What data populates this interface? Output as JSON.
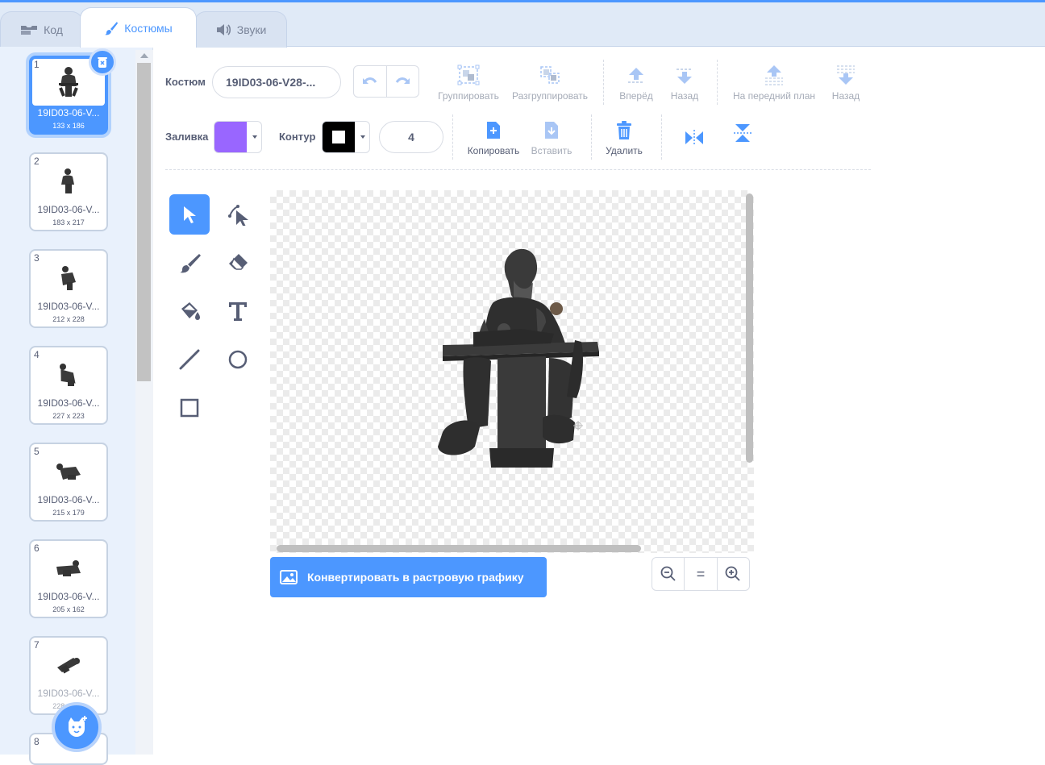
{
  "tabs": [
    {
      "label": "Код",
      "icon": "code-blocks-icon"
    },
    {
      "label": "Костюмы",
      "icon": "paintbrush-icon"
    },
    {
      "label": "Звуки",
      "icon": "speaker-icon"
    }
  ],
  "costumes": [
    {
      "number": "1",
      "name": "19ID03-06-V...",
      "size": "133 x 186"
    },
    {
      "number": "2",
      "name": "19ID03-06-V...",
      "size": "183 x 217"
    },
    {
      "number": "3",
      "name": "19ID03-06-V...",
      "size": "212 x 228"
    },
    {
      "number": "4",
      "name": "19ID03-06-V...",
      "size": "227 x 223"
    },
    {
      "number": "5",
      "name": "19ID03-06-V...",
      "size": "215 x 179"
    },
    {
      "number": "6",
      "name": "19ID03-06-V...",
      "size": "205 x 162"
    },
    {
      "number": "7",
      "name": "19ID03-06-V...",
      "size": "228 x 227"
    },
    {
      "number": "8",
      "name": "",
      "size": ""
    }
  ],
  "toolbar": {
    "costume_label": "Костюм",
    "costume_name": "19ID03-06-V28-...",
    "group": "Группировать",
    "ungroup": "Разгруппировать",
    "forward": "Вперёд",
    "backward": "Назад",
    "front": "На передний план",
    "back": "Назад",
    "fill_label": "Заливка",
    "fill_color": "#9966ff",
    "outline_label": "Контур",
    "outline_color": "#000000",
    "outline_width": "4",
    "copy": "Копировать",
    "paste": "Вставить",
    "delete": "Удалить"
  },
  "tools": [
    "select",
    "reshape",
    "brush",
    "eraser",
    "fill",
    "text",
    "line",
    "circle",
    "rectangle"
  ],
  "canvas": {
    "convert_button": "Конвертировать в растровую графику",
    "zoom_reset_label": "="
  },
  "colors": {
    "accent": "#4c97ff",
    "text": "#575e75",
    "sidebar_bg": "#e9f1fc"
  }
}
